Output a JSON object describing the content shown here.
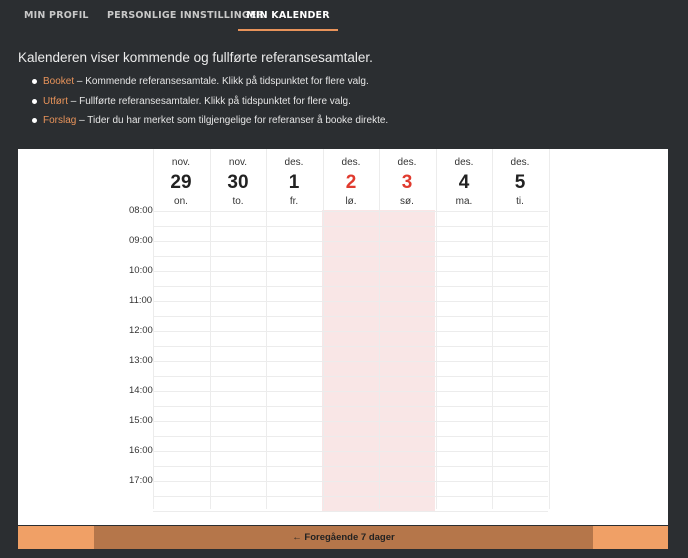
{
  "tabs": [
    {
      "label": "MIN PROFIL"
    },
    {
      "label": "PERSONLIGE INNSTILLINGER"
    },
    {
      "label": "MIN KALENDER",
      "active": true
    }
  ],
  "intro": "Kalenderen viser kommende og fullførte referansesamtaler.",
  "legend": [
    {
      "keyword": "Booket",
      "text": " – Kommende referansesamtale. Klikk på tidspunktet for flere valg."
    },
    {
      "keyword": "Utført",
      "text": " – Fullførte referansesamtaler. Klikk på tidspunktet for flere valg."
    },
    {
      "keyword": "Forslag",
      "text": " – Tider du har merket som tilgjengelige for referanser å booke direkte."
    }
  ],
  "calendar": {
    "days": [
      {
        "month": "nov.",
        "day": "29",
        "weekday": "on.",
        "weekend": false
      },
      {
        "month": "nov.",
        "day": "30",
        "weekday": "to.",
        "weekend": false
      },
      {
        "month": "des.",
        "day": "1",
        "weekday": "fr.",
        "weekend": false
      },
      {
        "month": "des.",
        "day": "2",
        "weekday": "lø.",
        "weekend": true
      },
      {
        "month": "des.",
        "day": "3",
        "weekday": "sø.",
        "weekend": true
      },
      {
        "month": "des.",
        "day": "4",
        "weekday": "ma.",
        "weekend": false
      },
      {
        "month": "des.",
        "day": "5",
        "weekday": "ti.",
        "weekend": false
      }
    ],
    "hours": [
      "08:00",
      "09:00",
      "10:00",
      "11:00",
      "12:00",
      "13:00",
      "14:00",
      "15:00",
      "16:00",
      "17:00"
    ]
  },
  "nav": {
    "prev_label": "← Foregående 7 dager"
  },
  "colors": {
    "accent": "#e8935a",
    "weekend": "#f9e6e6",
    "weekend_date": "#e03a2e",
    "background": "#2b2e31"
  }
}
